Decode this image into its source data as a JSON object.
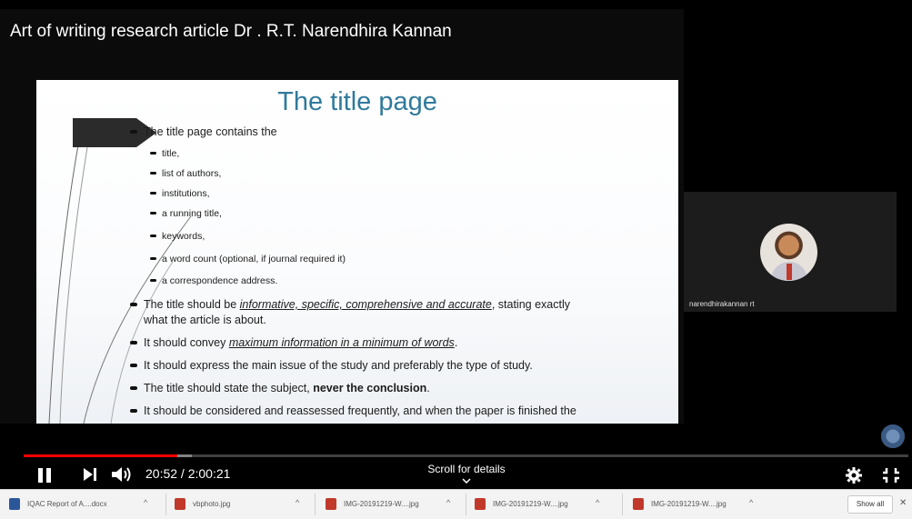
{
  "video": {
    "title": "Art of writing research article Dr . R.T. Narendhira Kannan"
  },
  "slide": {
    "title": "The title page",
    "bullets": [
      {
        "level": 1,
        "text": "The title page contains the"
      },
      {
        "level": 2,
        "text": "title,"
      },
      {
        "level": 2,
        "text": "list of authors,"
      },
      {
        "level": 2,
        "text": "institutions,"
      },
      {
        "level": 2,
        "text": "a running title,"
      },
      {
        "level": 2,
        "text": "keywords,"
      },
      {
        "level": 2,
        "text": "a word count (optional, if journal required it)"
      },
      {
        "level": 2,
        "text": "a correspondence address."
      }
    ],
    "b9": {
      "pre": "The title should be ",
      "em": "informative, specific, comprehensive and accurate",
      "post": ", stating exactly",
      "line2": "what the article is about."
    },
    "b10": {
      "pre": "It should convey ",
      "em": "maximum information in a minimum of words",
      "post": "."
    },
    "b11": {
      "text": "It should express the main issue of the study and preferably the type of study."
    },
    "b12": {
      "pre": "The title should state the subject, ",
      "strong": "never the conclusion",
      "post": "."
    },
    "b13": {
      "text": "It should be considered and reassessed frequently, and when the paper is finished the"
    }
  },
  "participant": {
    "name": "narendhirakannan rt"
  },
  "player": {
    "current_time": "20:52",
    "separator": " / ",
    "duration": "2:00:21",
    "progress_fraction": 0.1734,
    "loaded_fraction": 0.19,
    "scroll_hint": "Scroll for details",
    "accent_color": "#ff0000"
  },
  "downloads": {
    "items": [
      {
        "name": "IQAC Report of A....docx",
        "icon": "word-doc-icon",
        "color": "#2b579a"
      },
      {
        "name": "vbphoto.jpg",
        "icon": "image-file-icon",
        "color": "#c0392b"
      },
      {
        "name": "IMG-20191219-W....jpg",
        "icon": "image-file-icon",
        "color": "#c0392b"
      },
      {
        "name": "IMG-20191219-W....jpg",
        "icon": "image-file-icon",
        "color": "#c0392b"
      },
      {
        "name": "IMG-20191219-W....jpg",
        "icon": "image-file-icon",
        "color": "#c0392b"
      }
    ],
    "show_all": "Show all"
  }
}
